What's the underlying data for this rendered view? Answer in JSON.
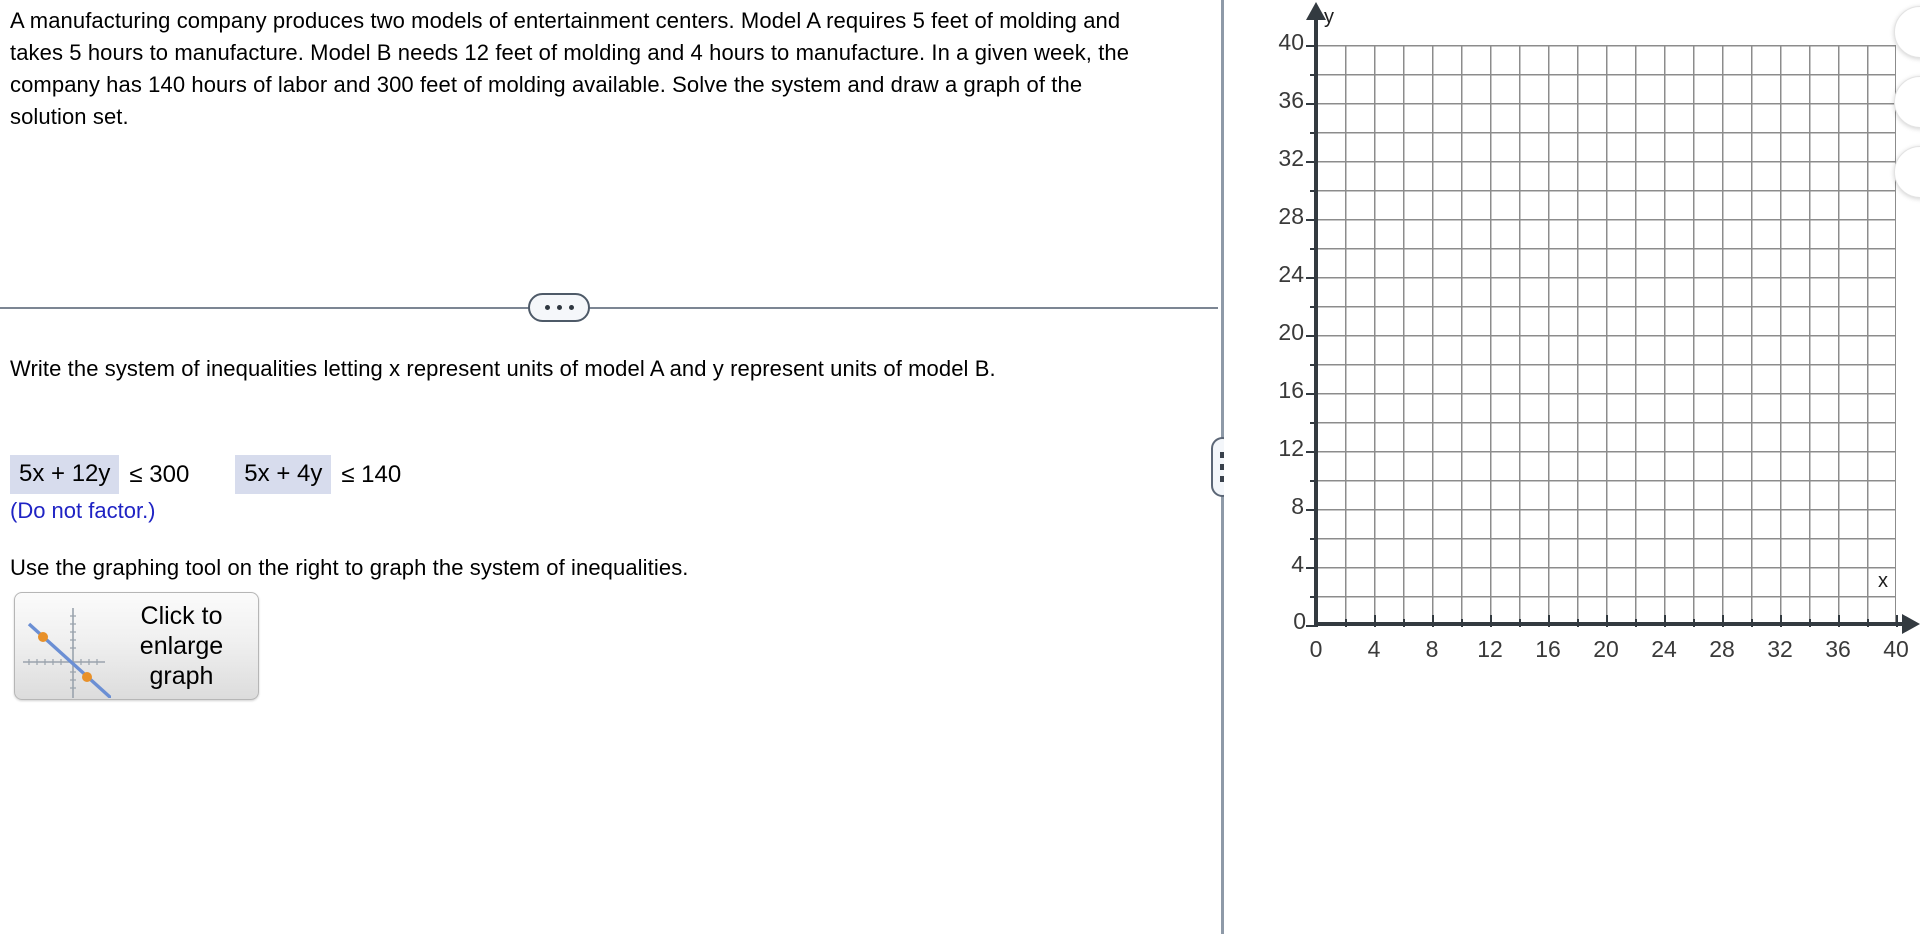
{
  "problem": {
    "statement": "A manufacturing company produces two models of entertainment centers. Model A requires 5 feet of molding and takes 5 hours to manufacture. Model B needs 12 feet of molding and 4 hours to manufacture. In a given week, the company has 140 hours of labor and 300 feet of molding available. Solve the system and draw a graph of the solution set."
  },
  "divider": {
    "dots_label": "..."
  },
  "question": {
    "instruction": "Write the system of inequalities letting x represent units of model A and y represent units of model B.",
    "answers": [
      {
        "box_value": "5x + 12y",
        "relation": "≤ 300"
      },
      {
        "box_value": "5x + 4y",
        "relation": "≤ 140"
      }
    ],
    "note": "(Do not factor.)",
    "graphing_instruction": "Use the graphing tool on the right to graph the system of inequalities."
  },
  "enlarge_button": {
    "label": "Click to enlarge graph",
    "icon": "mini-graph-icon",
    "line_color": "#6b8fd4",
    "point_color": "#e8912a",
    "axis_color": "#9aa3ad"
  },
  "splitter": {
    "handle_icon": "vertical-drag-handle-icon"
  },
  "chart_data": {
    "type": "scatter",
    "title": "",
    "xlabel": "x",
    "ylabel": "y",
    "xlim": [
      0,
      40
    ],
    "ylim": [
      0,
      40
    ],
    "x_ticks": [
      0,
      4,
      8,
      12,
      16,
      20,
      24,
      28,
      32,
      36,
      40
    ],
    "y_ticks": [
      0,
      4,
      8,
      12,
      16,
      20,
      24,
      28,
      32,
      36,
      40
    ],
    "x_tick_labels": [
      "0",
      "4",
      "8",
      "12",
      "16",
      "20",
      "24",
      "28",
      "32",
      "36",
      "40"
    ],
    "y_tick_labels": [
      "0",
      "4",
      "8",
      "12",
      "16",
      "20",
      "24",
      "28",
      "32",
      "36",
      "40"
    ],
    "minor_tick_step": 2,
    "grid": true,
    "grid_step": 2,
    "grid_color": "#8c8c8c",
    "axis_color": "#333a40",
    "series": [],
    "origin_label": "0",
    "legend": "none",
    "annotations": []
  },
  "edge_buttons": [
    {
      "name": "edge-button-1"
    },
    {
      "name": "edge-button-2"
    },
    {
      "name": "edge-button-3"
    }
  ]
}
